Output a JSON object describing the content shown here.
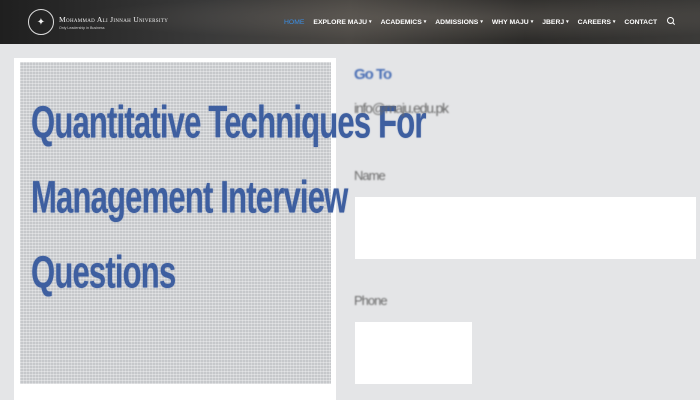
{
  "header": {
    "logo_name": "Mohammad Ali Jinnah University",
    "logo_tagline": "Only Leadership in Business"
  },
  "nav": {
    "items": [
      {
        "label": "HOME",
        "active": true,
        "dropdown": false
      },
      {
        "label": "EXPLORE MAJU",
        "active": false,
        "dropdown": true
      },
      {
        "label": "ACADEMICS",
        "active": false,
        "dropdown": true
      },
      {
        "label": "ADMISSIONS",
        "active": false,
        "dropdown": true
      },
      {
        "label": "WHY MAJU",
        "active": false,
        "dropdown": true
      },
      {
        "label": "JBERJ",
        "active": false,
        "dropdown": true
      },
      {
        "label": "CAREERS",
        "active": false,
        "dropdown": true
      },
      {
        "label": "CONTACT",
        "active": false,
        "dropdown": false
      }
    ],
    "search_icon": "search-icon"
  },
  "banner": {
    "line1": "Quantitative Techniques For",
    "line2": "Management Interview",
    "line3": "Questions"
  },
  "form": {
    "top_link": "Go To",
    "email": "info@maju.edu.pk",
    "field1_label": "Name",
    "field1_value": "",
    "field2_label": "Phone",
    "field2_value": ""
  },
  "colors": {
    "accent": "#3a8ee6",
    "banner_text": "#3e5fa0",
    "page_bg": "#e4e5e7"
  }
}
